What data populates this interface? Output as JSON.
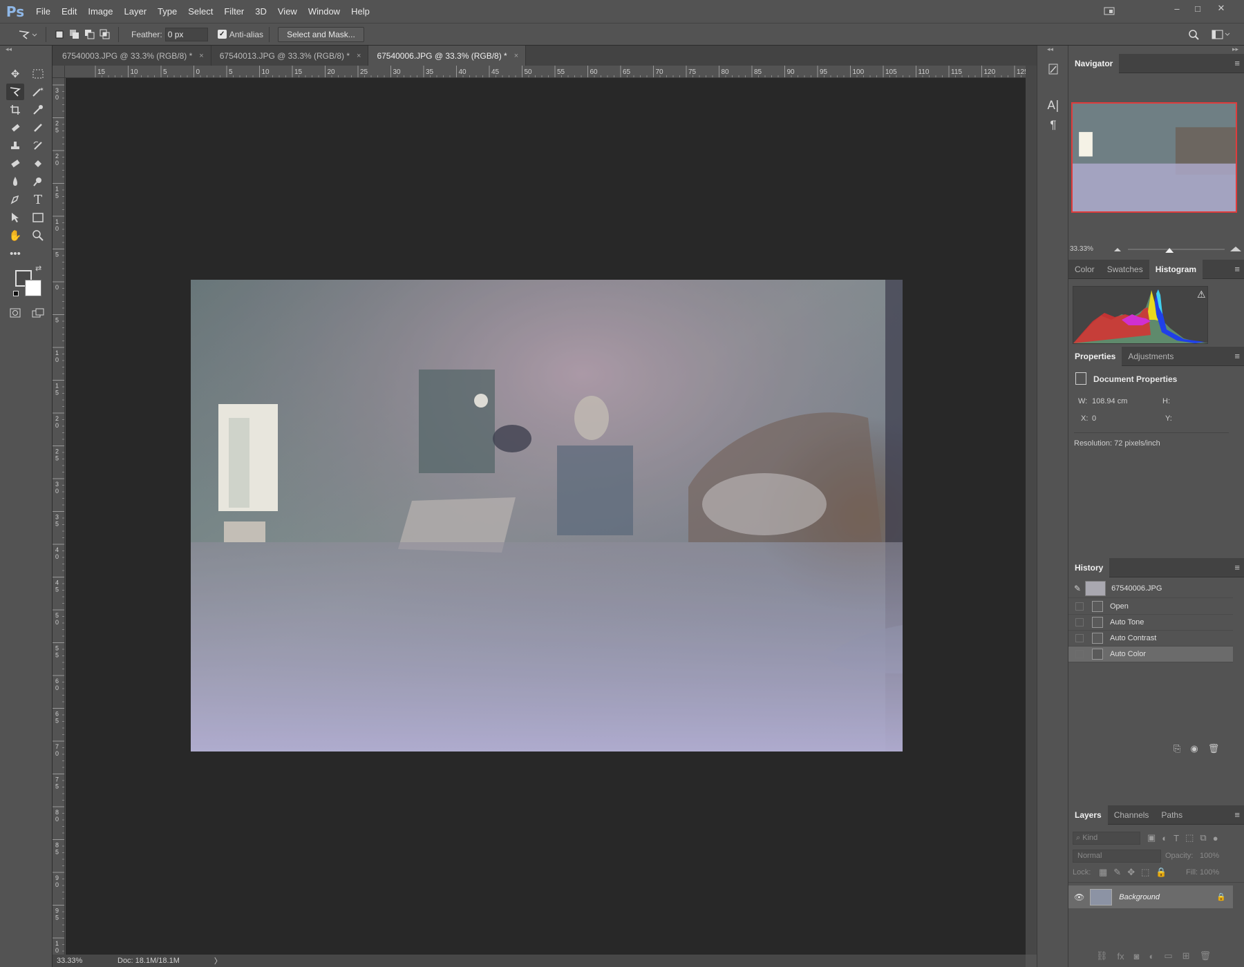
{
  "app": {
    "logo": "Ps"
  },
  "menu": [
    "File",
    "Edit",
    "Image",
    "Layer",
    "Type",
    "Select",
    "Filter",
    "3D",
    "View",
    "Window",
    "Help"
  ],
  "window_controls": {
    "minimize": "–",
    "maximize": "□",
    "close": "✕"
  },
  "options_bar": {
    "feather_label": "Feather:",
    "feather_value": "0 px",
    "anti_alias_label": "Anti-alias",
    "anti_alias_checked": true,
    "select_mask_label": "Select and Mask..."
  },
  "tabs": [
    {
      "label": "67540003.JPG @ 33.3% (RGB/8) *",
      "close": "×",
      "active": false
    },
    {
      "label": "67540013.JPG @ 33.3% (RGB/8) *",
      "close": "×",
      "active": false
    },
    {
      "label": "67540006.JPG @ 33.3% (RGB/8) *",
      "close": "×",
      "active": true
    }
  ],
  "ruler_h_labels": [
    "15",
    "10",
    "5",
    "0",
    "5",
    "10",
    "15",
    "20",
    "25",
    "30",
    "35",
    "40",
    "45",
    "50",
    "55",
    "60",
    "65",
    "70",
    "75",
    "80",
    "85",
    "90",
    "95",
    "100",
    "105",
    "110",
    "115",
    "120",
    "125"
  ],
  "ruler_v_labels": [
    "30",
    "25",
    "20",
    "15",
    "10",
    "5",
    "0",
    "5",
    "10",
    "15",
    "20",
    "25",
    "30",
    "35",
    "40",
    "45",
    "50",
    "55",
    "60",
    "65",
    "70",
    "75",
    "80",
    "85",
    "90",
    "95",
    "100"
  ],
  "status": {
    "zoom": "33.33%",
    "doc": "Doc: 18.1M/18.1M",
    "arrow": "〉"
  },
  "navigator": {
    "title": "Navigator",
    "zoom": "33.33%",
    "zoom_fraction": 0.43
  },
  "color_panel": {
    "tabs": [
      "Color",
      "Swatches",
      "Histogram"
    ],
    "active": "Histogram",
    "warning": "⚠"
  },
  "properties": {
    "tabs": [
      "Properties",
      "Adjustments"
    ],
    "active": "Properties",
    "heading": "Document Properties",
    "w_label": "W:",
    "w_value": "108.94 cm",
    "h_label": "H:",
    "h_value": "",
    "x_label": "X:",
    "x_value": "0",
    "y_label": "Y:",
    "y_value": "",
    "resolution": "Resolution: 72 pixels/inch"
  },
  "history": {
    "title": "History",
    "snapshot": "67540006.JPG",
    "items": [
      "Open",
      "Auto Tone",
      "Auto Contrast",
      "Auto Color"
    ],
    "selected": "Auto Color"
  },
  "layers": {
    "tabs": [
      "Layers",
      "Channels",
      "Paths"
    ],
    "active": "Layers",
    "kind_placeholder": "Kind",
    "blend_mode": "Normal",
    "opacity_label": "Opacity:",
    "opacity_value": "100%",
    "lock_label": "Lock:",
    "fill_label": "Fill:",
    "fill_value": "100%",
    "layer_name": "Background"
  }
}
